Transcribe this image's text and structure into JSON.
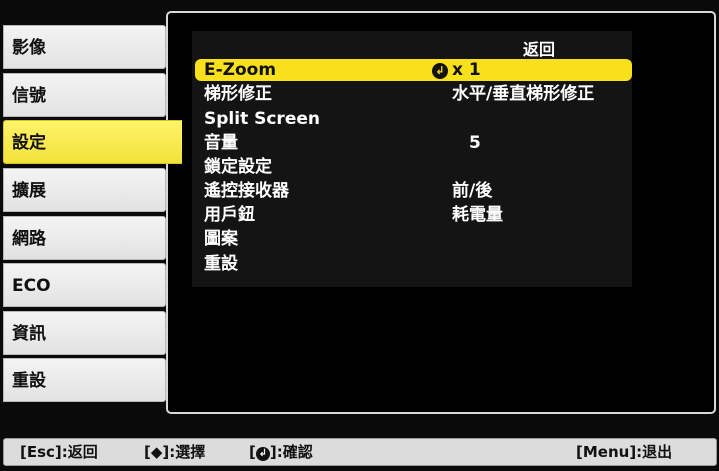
{
  "tabs": [
    {
      "label": "影像",
      "selected": false
    },
    {
      "label": "信號",
      "selected": false
    },
    {
      "label": "設定",
      "selected": true
    },
    {
      "label": "擴展",
      "selected": false
    },
    {
      "label": "網路",
      "selected": false
    },
    {
      "label": "ECO",
      "selected": false
    },
    {
      "label": "資訊",
      "selected": false
    },
    {
      "label": "重設",
      "selected": false
    }
  ],
  "panel": {
    "back_label": "返回",
    "items": [
      {
        "label": "E-Zoom",
        "value": "x  1",
        "value_icon": "enter-icon",
        "active": true
      },
      {
        "label": "梯形修正",
        "value": "水平/垂直梯形修正"
      },
      {
        "label": "Split Screen",
        "value": ""
      },
      {
        "label": "音量",
        "value": "5"
      },
      {
        "label": "鎖定設定",
        "value": ""
      },
      {
        "label": "遙控接收器",
        "value": "前/後"
      },
      {
        "label": "用戶鈕",
        "value": "耗電量"
      },
      {
        "label": "圖案",
        "value": ""
      },
      {
        "label": "重設",
        "value": ""
      }
    ]
  },
  "helpbar": {
    "esc_key": "[Esc]",
    "esc_action": ":返回",
    "nav_open": "[",
    "nav_icon": "◆",
    "nav_close": "]",
    "nav_action": ":選擇",
    "enter_open": "[",
    "enter_icon": "↲",
    "enter_close": "]",
    "enter_action": ":確認",
    "menu_key": "[Menu]",
    "menu_action": ":退出"
  },
  "colors": {
    "selection": "#f8e11c",
    "tab_selected": "#f2e23a",
    "tab_normal": "#e8e8e8",
    "panel_bg": "#000000",
    "panel_border": "#d8d8d8"
  }
}
